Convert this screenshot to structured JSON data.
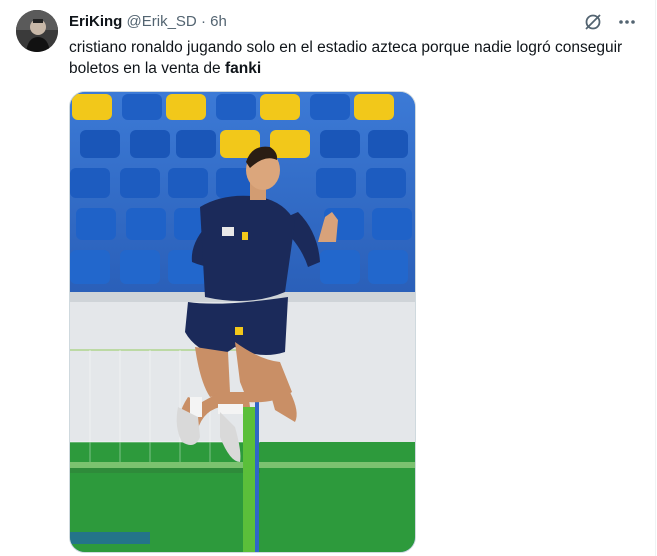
{
  "tweet": {
    "author_name": "EriKing",
    "author_handle": "@Erik_SD",
    "separator": "·",
    "time": "6h",
    "text_main": "cristiano ronaldo jugando solo en el estadio azteca porque nadie logró conseguir boletos en la venta de ",
    "text_bold": "fanki"
  },
  "icons": {
    "grok": "grok-icon",
    "more": "more-icon"
  },
  "colors": {
    "seat_blue": "#1f5fc4",
    "seat_yellow": "#f2c81a",
    "grass": "#2d9a3c",
    "kit_navy": "#1b2a5a"
  }
}
